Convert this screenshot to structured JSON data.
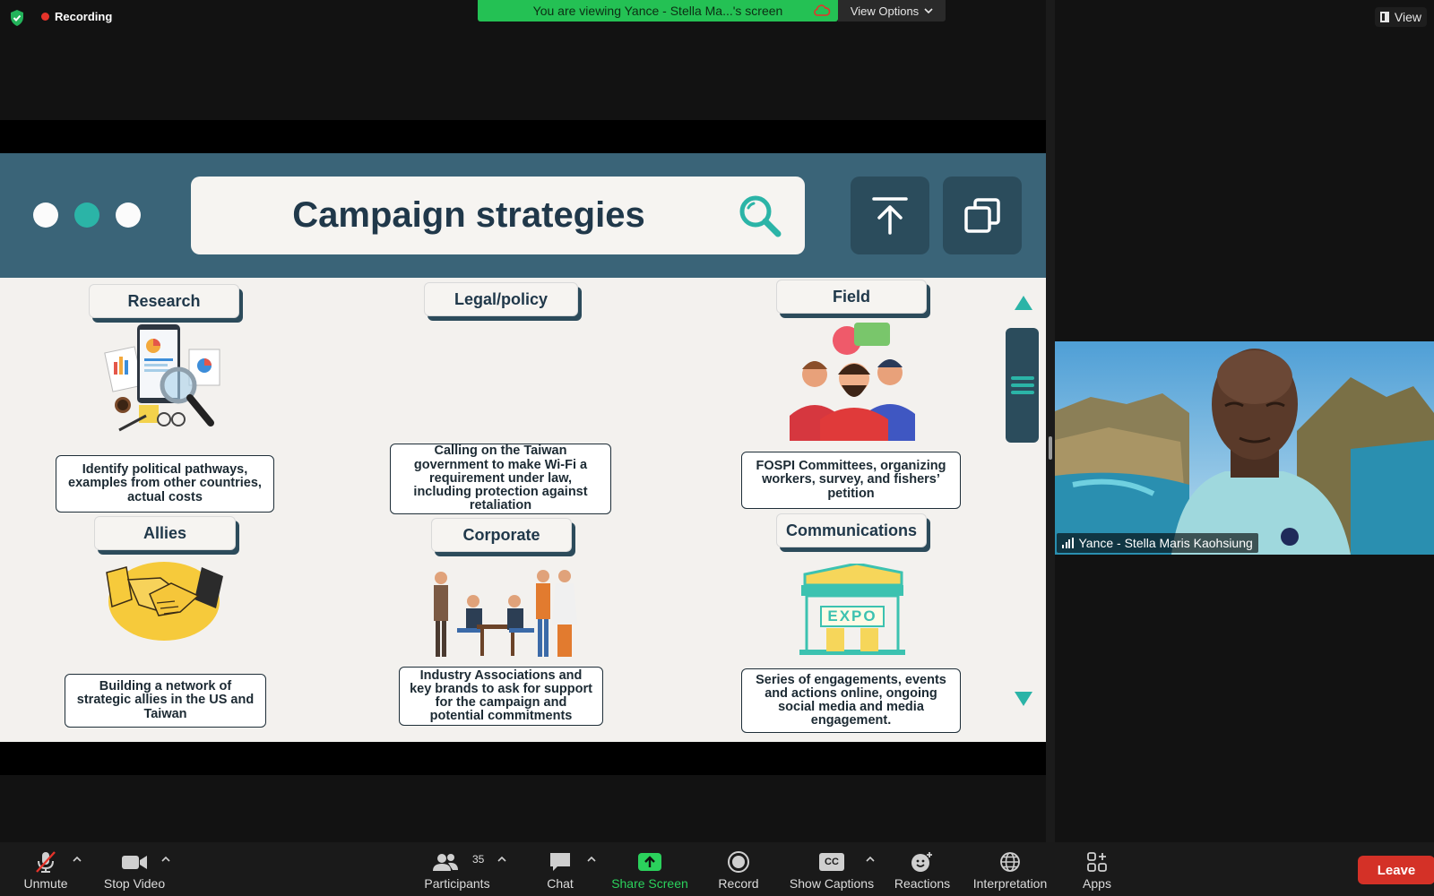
{
  "top_bar": {
    "recording_label": "Recording",
    "viewing_banner": "You are viewing Yance - Stella Ma...'s screen",
    "view_options_label": "View Options",
    "view_button_label": "View"
  },
  "slide": {
    "title": "Campaign strategies",
    "sections": [
      {
        "label": "Research",
        "description": "Identify political pathways, examples from other countries, actual costs"
      },
      {
        "label": "Legal/policy",
        "description": "Calling on the Taiwan government to make Wi-Fi a requirement under law, including protection against retaliation"
      },
      {
        "label": "Field",
        "description": "FOSPI Committees, organizing workers, survey, and fishers’ petition"
      },
      {
        "label": "Allies",
        "description": "Building a network of strategic allies in the US and Taiwan"
      },
      {
        "label": "Corporate",
        "description": "Industry Associations and key brands to ask for support for the campaign and potential commitments"
      },
      {
        "label": "Communications",
        "description": "Series of engagements, events and actions online, ongoing social media and media engagement."
      }
    ],
    "expo_sign": "EXPO"
  },
  "video": {
    "participant_name": "Yance - Stella Maris Kaohsiung"
  },
  "toolbar": {
    "unmute": "Unmute",
    "stop_video": "Stop Video",
    "participants": "Participants",
    "participants_count": "35",
    "chat": "Chat",
    "share_screen": "Share Screen",
    "record": "Record",
    "show_captions": "Show Captions",
    "captions_icon_text": "CC",
    "reactions": "Reactions",
    "interpretation": "Interpretation",
    "apps": "Apps",
    "leave": "Leave"
  },
  "colors": {
    "slide_header": "#3a6478",
    "accent_teal": "#2bb4a7",
    "share_green": "#24c154",
    "leave_red": "#d43127"
  }
}
